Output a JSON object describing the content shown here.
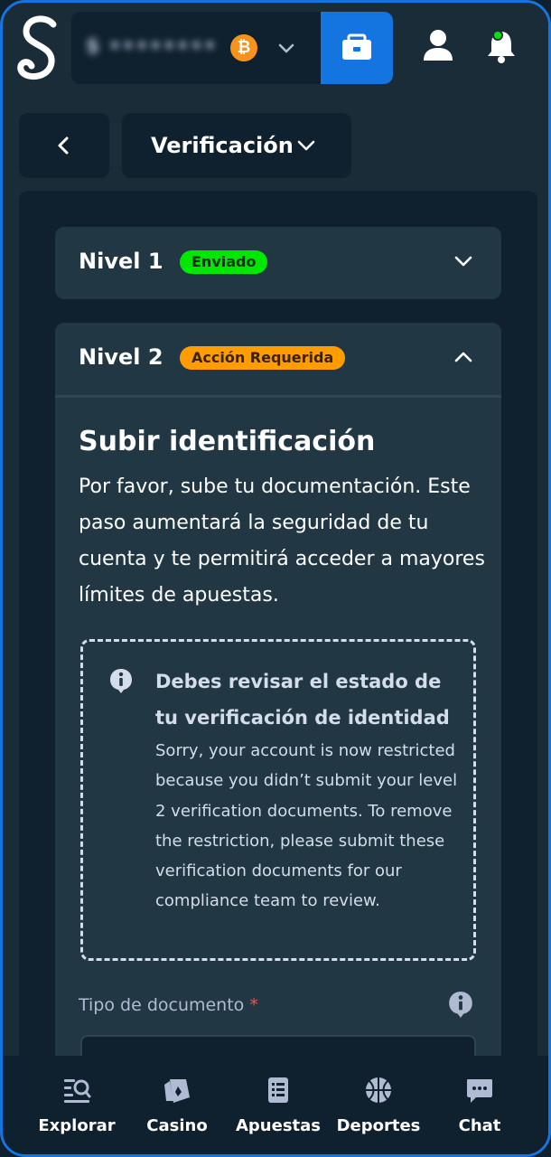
{
  "header": {
    "balance_masked": "$ ••••••••",
    "currency_icon": "bitcoin-icon",
    "wallet_icon": "wallet-icon",
    "profile_icon": "user-icon",
    "notifications_icon": "bell-icon",
    "accent_color": "#1475e1"
  },
  "subheader": {
    "back_icon": "chevron-left-icon",
    "section_label": "Verificación"
  },
  "levels": [
    {
      "title": "Nivel 1",
      "badge": "Enviado",
      "badge_color": "#00e701",
      "expanded": false
    },
    {
      "title": "Nivel 2",
      "badge": "Acción Requerida",
      "badge_color": "#ff9d00",
      "expanded": true
    }
  ],
  "upload": {
    "title": "Subir identificación",
    "description": "Por favor, sube tu documentación. Este paso aumentará la seguridad de tu cuenta y te permitirá acceder a mayores límites de apuestas."
  },
  "notice": {
    "title": "Debes revisar el estado de tu verificación de identidad",
    "body": "Sorry, your account is now restricted because you didn’t submit your level 2 verification documents. To remove the restriction, please submit these verification documents for our compliance team to review."
  },
  "document_type": {
    "label": "Tipo de documento",
    "required_mark": "*"
  },
  "bottom_nav": [
    {
      "label": "Explorar",
      "icon": "search-list-icon"
    },
    {
      "label": "Casino",
      "icon": "cards-icon"
    },
    {
      "label": "Apuestas",
      "icon": "betslip-icon"
    },
    {
      "label": "Deportes",
      "icon": "basketball-icon"
    },
    {
      "label": "Chat",
      "icon": "chat-icon"
    }
  ]
}
